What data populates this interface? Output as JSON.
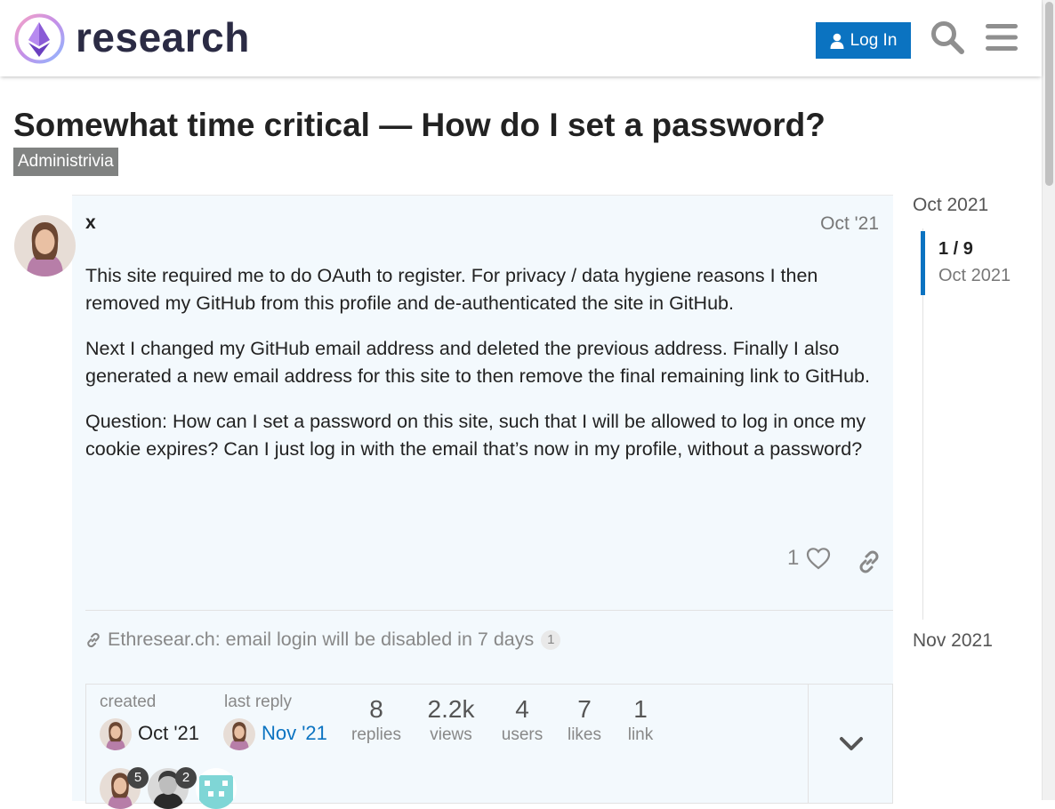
{
  "header": {
    "logo_text": "research",
    "login_label": "Log In",
    "search_icon": "search-icon",
    "menu_icon": "hamburger-menu-icon",
    "accent_color": "#0b73c1"
  },
  "topic": {
    "title": "Somewhat time critical — How do I set a password?",
    "category": "Administrivia"
  },
  "post": {
    "username": "x",
    "date": "Oct '21",
    "paragraphs": [
      "This site required me to do OAuth to register. For privacy / data hygiene reasons I then removed my GitHub from this profile and de-authenticated the site in GitHub.",
      "Next I changed my GitHub email address and deleted the previous address. Finally I also generated a new email address for this site to then remove the final remaining link to GitHub.",
      "Question: How can I set a password on this site, such that I will be allowed to log in once my cookie expires? Can I just log in with the email that’s now in my profile, without a password?"
    ],
    "like_count": "1",
    "linked_topic": {
      "title": "Ethresear.ch: email login will be disabled in 7 days",
      "count": "1"
    }
  },
  "summary": {
    "created_label": "created",
    "created_date": "Oct '21",
    "last_reply_label": "last reply",
    "last_reply_date": "Nov '21",
    "stats": [
      {
        "num": "8",
        "label": "replies"
      },
      {
        "num": "2.2k",
        "label": "views"
      },
      {
        "num": "4",
        "label": "users"
      },
      {
        "num": "7",
        "label": "likes"
      },
      {
        "num": "1",
        "label": "link"
      }
    ],
    "participants": [
      {
        "count": "5"
      },
      {
        "count": "2"
      },
      {
        "count": ""
      }
    ]
  },
  "timeline": {
    "start": "Oct 2021",
    "position": "1 / 9",
    "position_date": "Oct 2021",
    "end": "Nov 2021"
  }
}
